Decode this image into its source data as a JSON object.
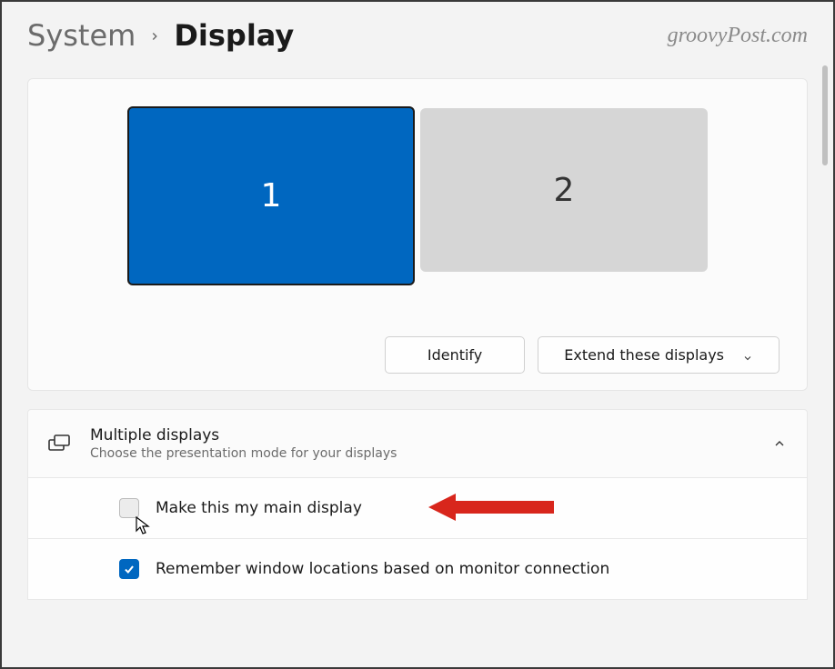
{
  "breadcrumb": {
    "parent": "System",
    "current": "Display"
  },
  "watermark": "groovyPost.com",
  "monitors": [
    {
      "label": "1",
      "selected": true
    },
    {
      "label": "2",
      "selected": false
    }
  ],
  "buttons": {
    "identify": "Identify",
    "extend": "Extend these displays"
  },
  "multiple_displays": {
    "title": "Multiple displays",
    "subtitle": "Choose the presentation mode for your displays"
  },
  "options": {
    "main_display": "Make this my main display",
    "remember_windows": "Remember window locations based on monitor connection"
  }
}
